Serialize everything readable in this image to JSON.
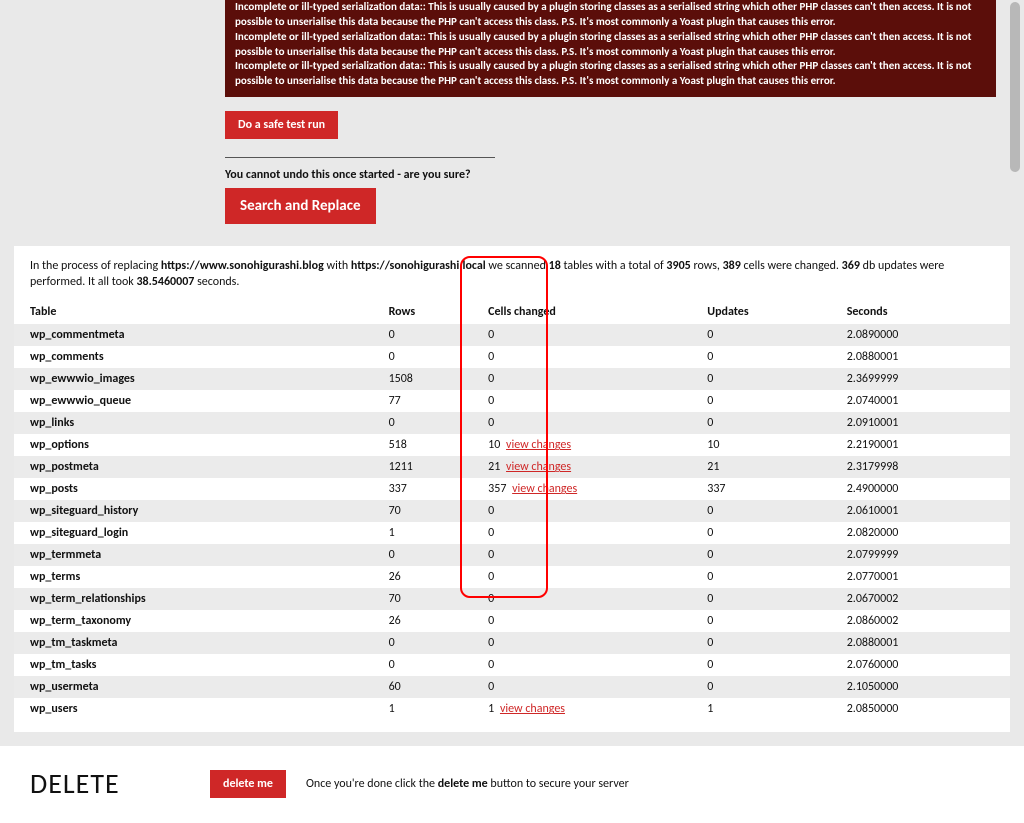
{
  "error": {
    "line_a": "Incomplete or ill-typed serialization data:: This is usually caused by a plugin storing classes as a serialised string which other PHP classes can't then access. It is not possible to unserialise this data because the PHP can't access this class. P.S. It's most commonly a Yoast plugin that causes this error.",
    "line_b": "Incomplete or ill-typed serialization data:: This is usually caused by a plugin storing classes as a serialised string which other PHP classes can't then access. It is not possible to unserialise this data because the PHP can't access this class. P.S. It's most commonly a Yoast plugin that causes this error.",
    "line_c": "Incomplete or ill-typed serialization data:: This is usually caused by a plugin storing classes as a serialised string which other PHP classes can't then access. It is not possible to unserialise this data because the PHP can't access this class. P.S. It's most commonly a Yoast plugin that causes this error."
  },
  "buttons": {
    "safe_test": "Do a safe test run",
    "search_replace": "Search and Replace",
    "delete_me": "delete me"
  },
  "undo_text": "You cannot undo this once started - are you sure?",
  "summary": {
    "prefix": "In the process of replacing ",
    "from_url": "https://www.sonohigurashi.blog",
    "with": " with ",
    "to_url": "https://sonohigurashi.local",
    "scanned": " we scanned ",
    "tables_count": "18",
    "tables_word": " tables with a total of ",
    "rows_count": "3905",
    "rows_word": " rows, ",
    "cells_count": "389",
    "cells_word": " cells were changed. ",
    "updates_count": "369",
    "updates_word": " db updates were performed. It all took ",
    "seconds": "38.5460007",
    "seconds_word": " seconds."
  },
  "headers": {
    "table": "Table",
    "rows": "Rows",
    "cells": "Cells changed",
    "updates": "Updates",
    "seconds": "Seconds"
  },
  "view_changes_label": "view changes",
  "rows": [
    {
      "table": "wp_commentmeta",
      "rows": "0",
      "cells": "0",
      "view": false,
      "updates": "0",
      "seconds": "2.0890000"
    },
    {
      "table": "wp_comments",
      "rows": "0",
      "cells": "0",
      "view": false,
      "updates": "0",
      "seconds": "2.0880001"
    },
    {
      "table": "wp_ewwwio_images",
      "rows": "1508",
      "cells": "0",
      "view": false,
      "updates": "0",
      "seconds": "2.3699999"
    },
    {
      "table": "wp_ewwwio_queue",
      "rows": "77",
      "cells": "0",
      "view": false,
      "updates": "0",
      "seconds": "2.0740001"
    },
    {
      "table": "wp_links",
      "rows": "0",
      "cells": "0",
      "view": false,
      "updates": "0",
      "seconds": "2.0910001"
    },
    {
      "table": "wp_options",
      "rows": "518",
      "cells": "10",
      "view": true,
      "updates": "10",
      "seconds": "2.2190001"
    },
    {
      "table": "wp_postmeta",
      "rows": "1211",
      "cells": "21",
      "view": true,
      "updates": "21",
      "seconds": "2.3179998"
    },
    {
      "table": "wp_posts",
      "rows": "337",
      "cells": "357",
      "view": true,
      "updates": "337",
      "seconds": "2.4900000"
    },
    {
      "table": "wp_siteguard_history",
      "rows": "70",
      "cells": "0",
      "view": false,
      "updates": "0",
      "seconds": "2.0610001"
    },
    {
      "table": "wp_siteguard_login",
      "rows": "1",
      "cells": "0",
      "view": false,
      "updates": "0",
      "seconds": "2.0820000"
    },
    {
      "table": "wp_termmeta",
      "rows": "0",
      "cells": "0",
      "view": false,
      "updates": "0",
      "seconds": "2.0799999"
    },
    {
      "table": "wp_terms",
      "rows": "26",
      "cells": "0",
      "view": false,
      "updates": "0",
      "seconds": "2.0770001"
    },
    {
      "table": "wp_term_relationships",
      "rows": "70",
      "cells": "0",
      "view": false,
      "updates": "0",
      "seconds": "2.0670002"
    },
    {
      "table": "wp_term_taxonomy",
      "rows": "26",
      "cells": "0",
      "view": false,
      "updates": "0",
      "seconds": "2.0860002"
    },
    {
      "table": "wp_tm_taskmeta",
      "rows": "0",
      "cells": "0",
      "view": false,
      "updates": "0",
      "seconds": "2.0880001"
    },
    {
      "table": "wp_tm_tasks",
      "rows": "0",
      "cells": "0",
      "view": false,
      "updates": "0",
      "seconds": "2.0760000"
    },
    {
      "table": "wp_usermeta",
      "rows": "60",
      "cells": "0",
      "view": false,
      "updates": "0",
      "seconds": "2.1050000"
    },
    {
      "table": "wp_users",
      "rows": "1",
      "cells": "1",
      "view": true,
      "updates": "1",
      "seconds": "2.0850000"
    }
  ],
  "delete": {
    "heading": "DELETE",
    "help_pre": "Once you're done click the ",
    "help_bold": "delete me",
    "help_post": " button to secure your server"
  }
}
